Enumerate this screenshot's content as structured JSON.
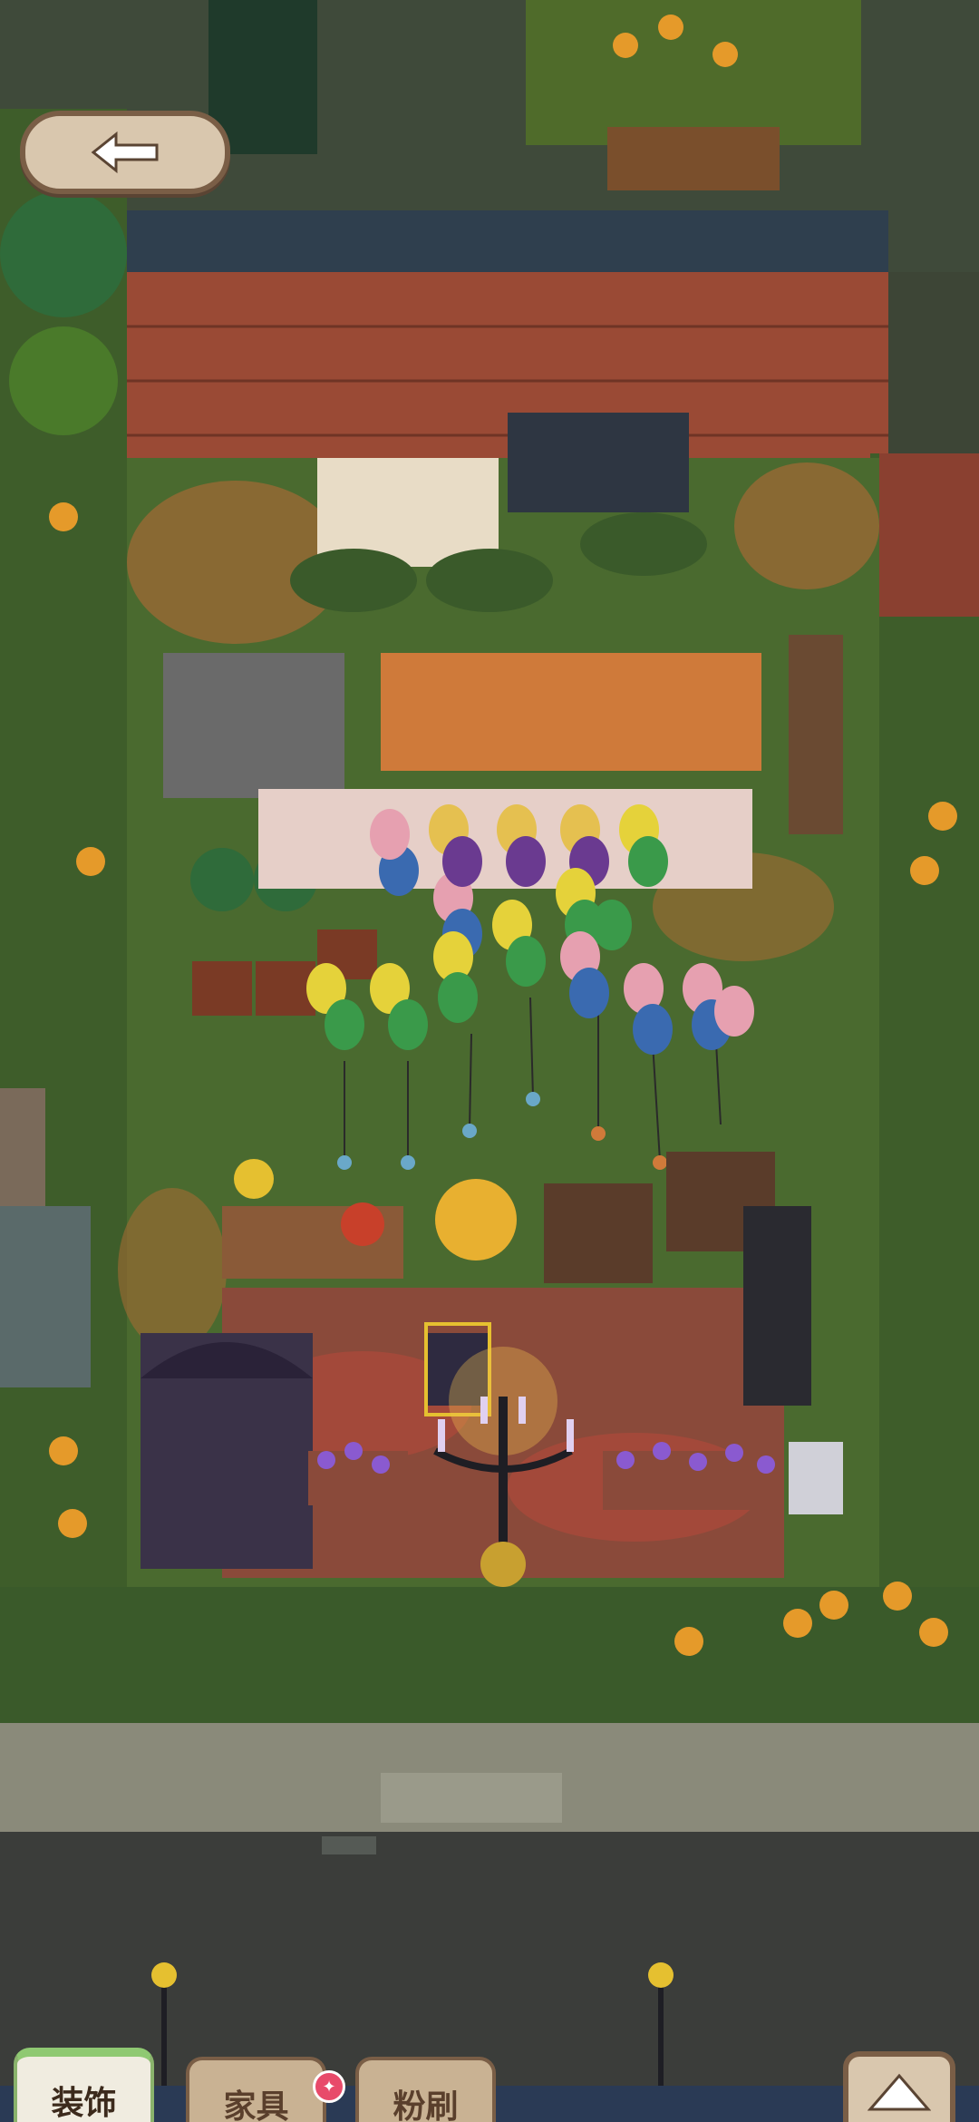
{
  "game": {
    "scene": "garden-lot",
    "tabs": [
      {
        "label": "装饰",
        "active": true
      },
      {
        "label": "家具",
        "active": false
      },
      {
        "label": "粉刷",
        "active": false
      }
    ],
    "icons": {
      "back": "back-arrow-icon",
      "expand": "up-arrow-icon",
      "notification": "sparkle-badge-icon"
    },
    "colors": {
      "panel": "#d9c7ae",
      "panel_border": "#7a5e46",
      "grass": "#4a6a2f",
      "brick": "#9a4a35",
      "road": "#3b3d3a",
      "tab_active_accent": "#8fc972",
      "badge": "#e84a6a"
    }
  }
}
